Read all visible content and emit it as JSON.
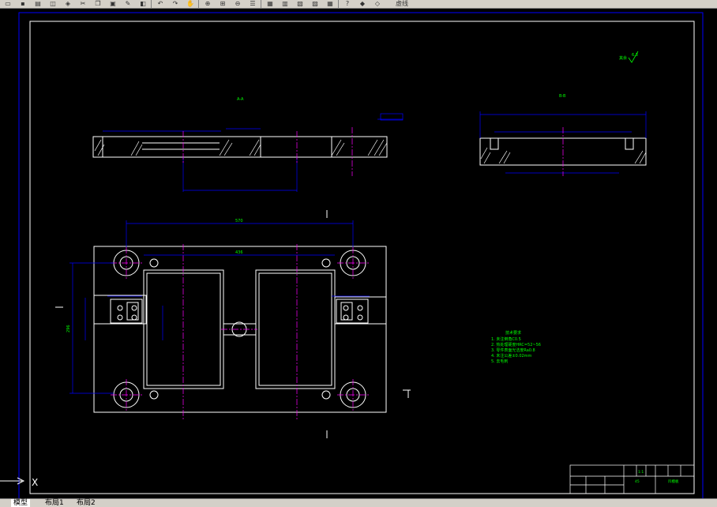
{
  "toolbar": {
    "buttons": [
      "open-file-icon",
      "save-icon",
      "print-icon",
      "preview-icon",
      "publish-icon",
      "cut-icon",
      "copy-icon",
      "paste-icon",
      "match-prop-icon",
      "block-editor-icon",
      "undo-icon",
      "redo-icon",
      "pan-icon",
      "zoom-realtime-icon",
      "zoom-window-icon",
      "zoom-previous-icon",
      "properties-icon",
      "design-center-icon",
      "tool-palettes-icon",
      "sheet-set-icon",
      "markup-icon",
      "calculator-icon",
      "help-icon",
      "layer-manager-icon",
      "layer-state-icon"
    ],
    "layer_name": "虚线"
  },
  "drawing": {
    "section_a_label": "A-A",
    "section_b_label": "B-B",
    "tech_req_title": "技术要求",
    "tech_req_lines": [
      "1. 未注倒角C0.5",
      "2. 热处理硬度HRC=52~56",
      "3. 零件表面光洁度Ra0.8",
      "4. 未注公差±0.02mm",
      "5. 去毛刺"
    ],
    "roughness_label": "其余",
    "roughness_value": "6.3",
    "dim_top_width": "570",
    "dim_inner_width": "436",
    "dim_height": "296",
    "title_block": {
      "name": "凹模板",
      "scale": "1:1",
      "material": "45"
    }
  },
  "colors": {
    "background": "#000000",
    "outline": "#ffffff",
    "dimension": "#0000ff",
    "centerline": "#ff00ff",
    "text": "#00ff00",
    "hatch": "#ffffff",
    "ui_gray": "#d4d0c8"
  },
  "ucs": {
    "label": "X"
  },
  "tabs": [
    "模型",
    "布局1",
    "布局2"
  ],
  "active_tab": "模型"
}
